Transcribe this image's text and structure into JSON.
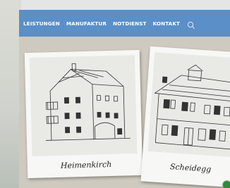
{
  "nav": {
    "items": [
      {
        "label": "LEISTUNGEN"
      },
      {
        "label": "MANUFAKTUR"
      },
      {
        "label": "NOTDIENST"
      },
      {
        "label": "KONTAKT"
      }
    ],
    "search_icon": "search-icon",
    "bar_color": "#5a8fc8"
  },
  "gallery": {
    "cards": [
      {
        "caption": "Heimenkirch"
      },
      {
        "caption": "Scheidegg"
      }
    ]
  }
}
